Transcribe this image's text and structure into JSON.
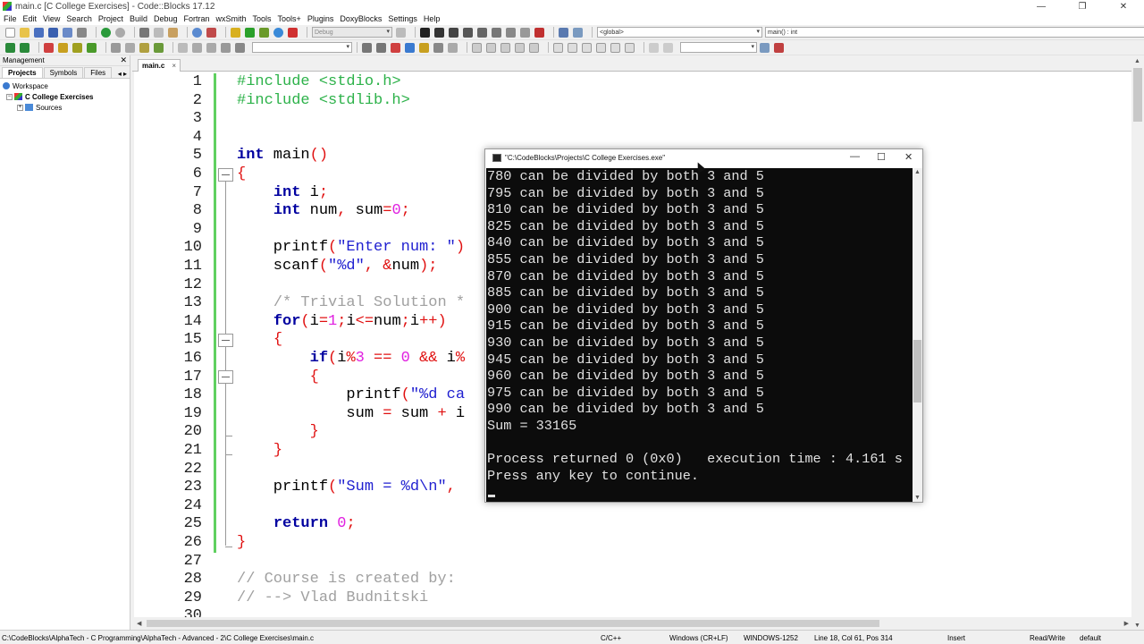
{
  "window": {
    "title": "main.c [C College Exercises] - Code::Blocks 17.12",
    "minimize": "—",
    "maximize": "❐",
    "close": "✕"
  },
  "menu": [
    "File",
    "Edit",
    "View",
    "Search",
    "Project",
    "Build",
    "Debug",
    "Fortran",
    "wxSmith",
    "Tools",
    "Tools+",
    "Plugins",
    "DoxyBlocks",
    "Settings",
    "Help"
  ],
  "toolbar": {
    "build_target": "Debug",
    "scope": "<global>",
    "symbol": "main() : int"
  },
  "management": {
    "title": "Management",
    "close": "✕",
    "tabs": [
      "Projects",
      "Symbols",
      "Files"
    ],
    "nav": "◂ ▸",
    "tree": {
      "workspace": "Workspace",
      "project": "C College Exercises",
      "sources": "Sources"
    }
  },
  "editor": {
    "tab": "main.c",
    "tab_close": "×"
  },
  "code": [
    {
      "n": "1",
      "html": "<span class='pp'>#include &lt;stdio.h&gt;</span>"
    },
    {
      "n": "2",
      "html": "<span class='pp'>#include &lt;stdlib.h&gt;</span>"
    },
    {
      "n": "3",
      "html": ""
    },
    {
      "n": "4",
      "html": ""
    },
    {
      "n": "5",
      "html": "<span class='kw'>int</span> main<span class='op'>()</span>"
    },
    {
      "n": "6",
      "html": "<span class='op'>{</span>"
    },
    {
      "n": "7",
      "html": "    <span class='kw'>int</span> i<span class='op'>;</span>"
    },
    {
      "n": "8",
      "html": "    <span class='kw'>int</span> num<span class='op'>,</span> sum<span class='op'>=</span><span class='num'>0</span><span class='op'>;</span>"
    },
    {
      "n": "9",
      "html": ""
    },
    {
      "n": "10",
      "html": "    printf<span class='op'>(</span><span class='str'>\"Enter num: \"</span><span class='op'>)</span>"
    },
    {
      "n": "11",
      "html": "    scanf<span class='op'>(</span><span class='str'>\"%d\"</span><span class='op'>,</span> <span class='op'>&amp;</span>num<span class='op'>);</span>"
    },
    {
      "n": "12",
      "html": ""
    },
    {
      "n": "13",
      "html": "    <span class='cm'>/* Trivial Solution *</span>"
    },
    {
      "n": "14",
      "html": "    <span class='kw'>for</span><span class='op'>(</span>i<span class='op'>=</span><span class='num'>1</span><span class='op'>;</span>i<span class='op'>&lt;=</span>num<span class='op'>;</span>i<span class='op'>++)</span>"
    },
    {
      "n": "15",
      "html": "    <span class='op'>{</span>"
    },
    {
      "n": "16",
      "html": "        <span class='kw'>if</span><span class='op'>(</span>i<span class='op'>%</span><span class='num'>3</span> <span class='op'>==</span> <span class='num'>0</span> <span class='op'>&amp;&amp;</span> i<span class='op'>%</span>"
    },
    {
      "n": "17",
      "html": "        <span class='op'>{</span>"
    },
    {
      "n": "18",
      "html": "            printf<span class='op'>(</span><span class='str'>\"%d ca</span>"
    },
    {
      "n": "19",
      "html": "            sum <span class='op'>=</span> sum <span class='op'>+</span> i"
    },
    {
      "n": "20",
      "html": "        <span class='op'>}</span>"
    },
    {
      "n": "21",
      "html": "    <span class='op'>}</span>"
    },
    {
      "n": "22",
      "html": ""
    },
    {
      "n": "23",
      "html": "    printf<span class='op'>(</span><span class='str'>\"Sum = %d\\n\"</span><span class='op'>,</span>"
    },
    {
      "n": "24",
      "html": ""
    },
    {
      "n": "25",
      "html": "    <span class='kw'>return</span> <span class='num'>0</span><span class='op'>;</span>"
    },
    {
      "n": "26",
      "html": "<span class='op'>}</span>"
    },
    {
      "n": "27",
      "html": ""
    },
    {
      "n": "28",
      "html": "<span class='cm'>// Course is created by:</span>"
    },
    {
      "n": "29",
      "html": "<span class='cm'>// --&gt; Vlad Budnitski</span>"
    },
    {
      "n": "30",
      "html": ""
    }
  ],
  "console": {
    "title": "\"C:\\CodeBlocks\\Projects\\C College Exercises.exe\"",
    "lines": [
      "780 can be divided by both 3 and 5",
      "795 can be divided by both 3 and 5",
      "810 can be divided by both 3 and 5",
      "825 can be divided by both 3 and 5",
      "840 can be divided by both 3 and 5",
      "855 can be divided by both 3 and 5",
      "870 can be divided by both 3 and 5",
      "885 can be divided by both 3 and 5",
      "900 can be divided by both 3 and 5",
      "915 can be divided by both 3 and 5",
      "930 can be divided by both 3 and 5",
      "945 can be divided by both 3 and 5",
      "960 can be divided by both 3 and 5",
      "975 can be divided by both 3 and 5",
      "990 can be divided by both 3 and 5",
      "Sum = 33165",
      "",
      "Process returned 0 (0x0)   execution time : 4.161 s",
      "Press any key to continue."
    ]
  },
  "statusbar": {
    "path": "C:\\CodeBlocks\\AlphaTech - C Programming\\AlphaTech - Advanced - 2\\C College Exercises\\main.c",
    "language": "C/C++",
    "line_endings": "Windows (CR+LF)",
    "encoding": "WINDOWS-1252",
    "position": "Line 18, Col 61, Pos 314",
    "insert": "Insert",
    "access": "Read/Write",
    "profile": "default"
  }
}
